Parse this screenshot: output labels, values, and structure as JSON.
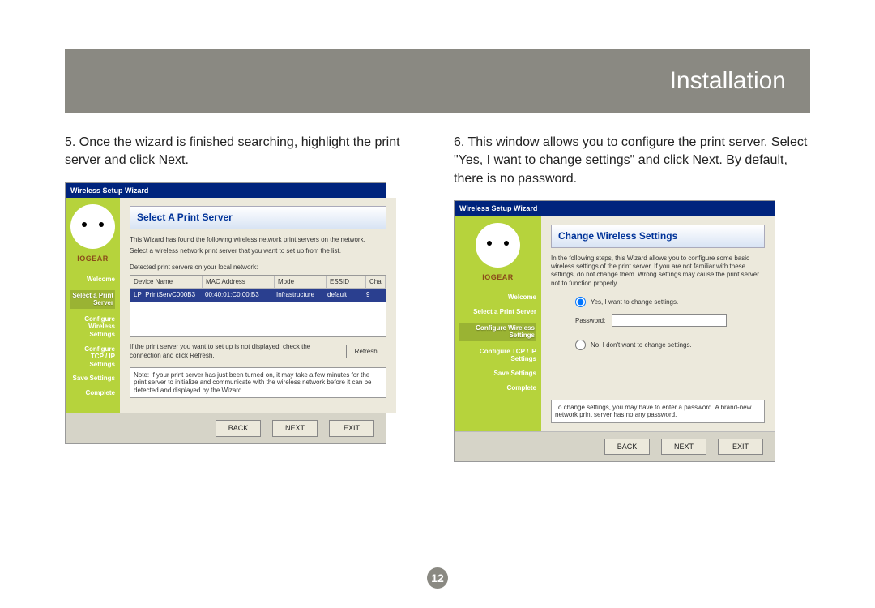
{
  "header": {
    "title": "Installation"
  },
  "pageNumber": "12",
  "left": {
    "stepText": "5.  Once the wizard is finished searching, highlight the print server and click Next.",
    "wizard": {
      "titlebar": "Wireless Setup Wizard",
      "brand": "IOGEAR",
      "sidebar": [
        "Welcome",
        "Select a Print Server",
        "Configure Wireless Settings",
        "Configure TCP / IP Settings",
        "Save Settings",
        "Complete"
      ],
      "activeIndex": 1,
      "paneTitle": "Select A Print Server",
      "intro1": "This Wizard has found the following wireless network print servers on the network.",
      "intro2": "Select a wireless network print server that you want to set up from the list.",
      "listLabel": "Detected print servers on your local network:",
      "headers": [
        "Device Name",
        "MAC Address",
        "Mode",
        "ESSID",
        "Cha"
      ],
      "row": [
        "LP_PrintServC000B3",
        "00:40:01:C0:00:B3",
        "Infrastructure",
        "default",
        "9"
      ],
      "refreshText": "If the print server you want to set up is not displayed, check the connection and click Refresh.",
      "refreshBtn": "Refresh",
      "note": "Note: If your print server has just been turned on, it may take a few minutes for the print server to initialize and communicate with the wireless network before it can be detected and displayed by the Wizard.",
      "buttons": [
        "BACK",
        "NEXT",
        "EXIT"
      ]
    }
  },
  "right": {
    "stepText": "6.  This window allows you to configure the print server. Select \"Yes, I want to change settings\" and click Next. By default, there is no password.",
    "wizard": {
      "titlebar": "Wireless Setup Wizard",
      "brand": "IOGEAR",
      "sidebar": [
        "Welcome",
        "Select a Print Server",
        "Configure Wireless Settings",
        "Configure TCP / IP Settings",
        "Save Settings",
        "Complete"
      ],
      "activeIndex": 2,
      "paneTitle": "Change Wireless Settings",
      "intro1": "In the following steps, this Wizard allows you to configure some basic wireless settings of the print server. If you are not familiar with these settings, do not change them. Wrong settings may cause the print server not to function properly.",
      "optYes": "Yes, I want to change settings.",
      "pwLabel": "Password:",
      "optNo": "No, I don't want to change settings.",
      "note": "To change settings, you may have to enter a password. A brand-new network print server has no any password.",
      "buttons": [
        "BACK",
        "NEXT",
        "EXIT"
      ]
    }
  }
}
